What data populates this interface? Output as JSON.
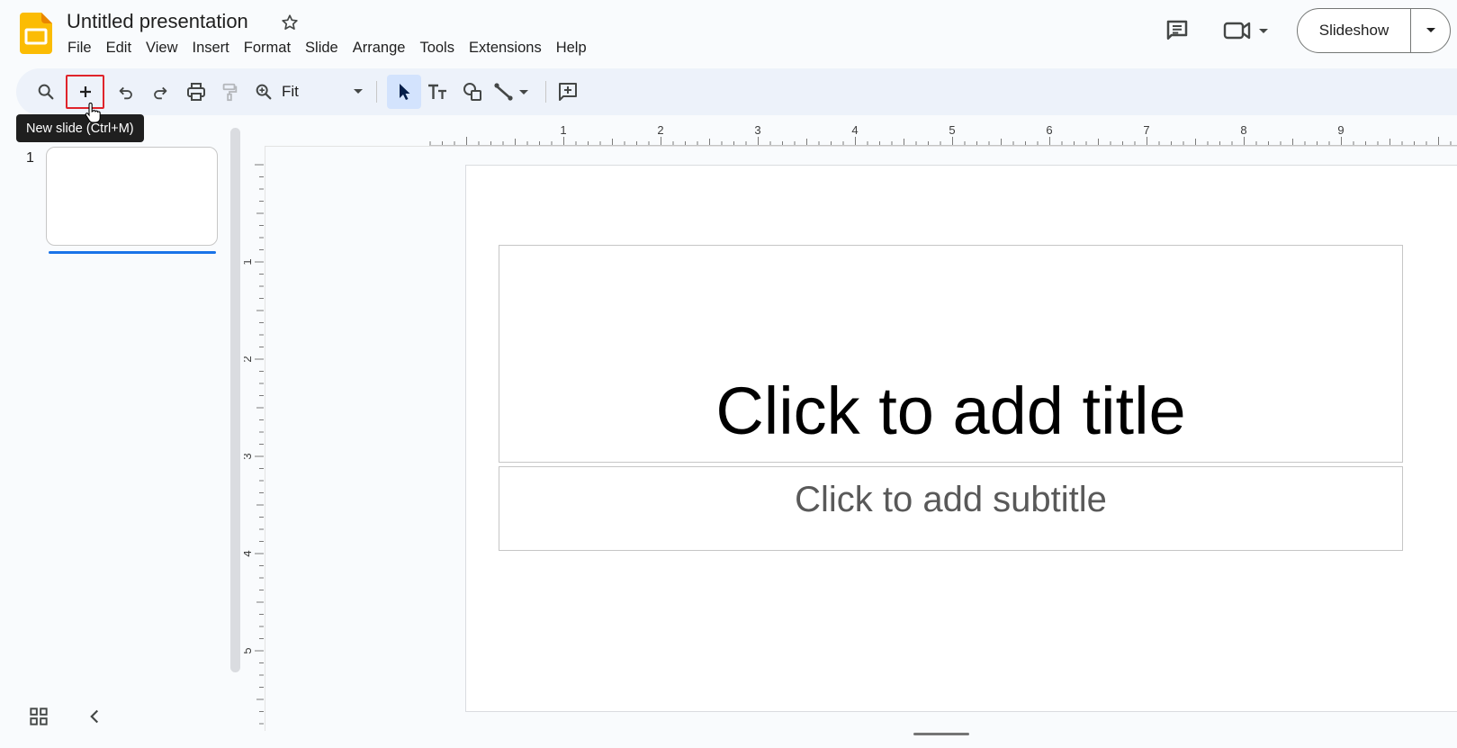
{
  "app": {
    "doc_title": "Untitled presentation",
    "brand_color": "#fbbc04"
  },
  "menu": [
    "File",
    "Edit",
    "View",
    "Insert",
    "Format",
    "Slide",
    "Arrange",
    "Tools",
    "Extensions",
    "Help"
  ],
  "header": {
    "slideshow_label": "Slideshow",
    "icons": [
      "comments-icon",
      "video-camera-icon",
      "chevron-down-icon"
    ]
  },
  "toolbar": {
    "zoom_value": "Fit",
    "tools": [
      "search-icon",
      "plus-icon",
      "undo-icon",
      "redo-icon",
      "print-icon",
      "paint-format-icon",
      "zoom-icon",
      "cursor-icon",
      "text-box-icon",
      "shape-icon",
      "line-icon",
      "add-comment-icon"
    ]
  },
  "tooltip": {
    "text": "New slide (Ctrl+M)"
  },
  "filmstrip": {
    "slides": [
      {
        "number": "1"
      }
    ]
  },
  "ruler": {
    "h_labels": [
      "1",
      "2",
      "3",
      "4",
      "5",
      "6",
      "7",
      "8",
      "9"
    ],
    "v_labels": [
      "1",
      "2",
      "3",
      "4",
      "5"
    ]
  },
  "slide": {
    "title_placeholder": "Click to add title",
    "subtitle_placeholder": "Click to add subtitle"
  },
  "colors": {
    "accent": "#1a73e8",
    "selected_tool_bg": "#d3e3fd",
    "highlight_box": "#e0242b",
    "toolbar_bg": "#edf2fa"
  }
}
